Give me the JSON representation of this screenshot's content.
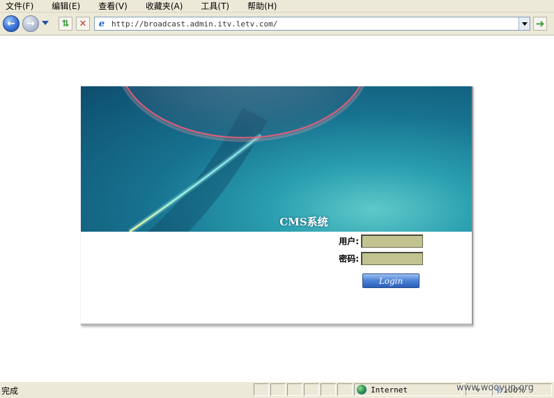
{
  "menubar": {
    "items": [
      "文件(F)",
      "编辑(E)",
      "查看(V)",
      "收藏夹(A)",
      "工具(T)",
      "帮助(H)"
    ]
  },
  "toolbar": {
    "address": "http://broadcast.admin.itv.letv.com/"
  },
  "page": {
    "banner_title": "CMS系统",
    "username_label": "用户:",
    "password_label": "密码:",
    "username_value": "",
    "password_value": "",
    "login_label": "Login"
  },
  "statusbar": {
    "status": "完成",
    "zone": "Internet",
    "zoom": "100%"
  },
  "watermark": "www.wooyun.org"
}
